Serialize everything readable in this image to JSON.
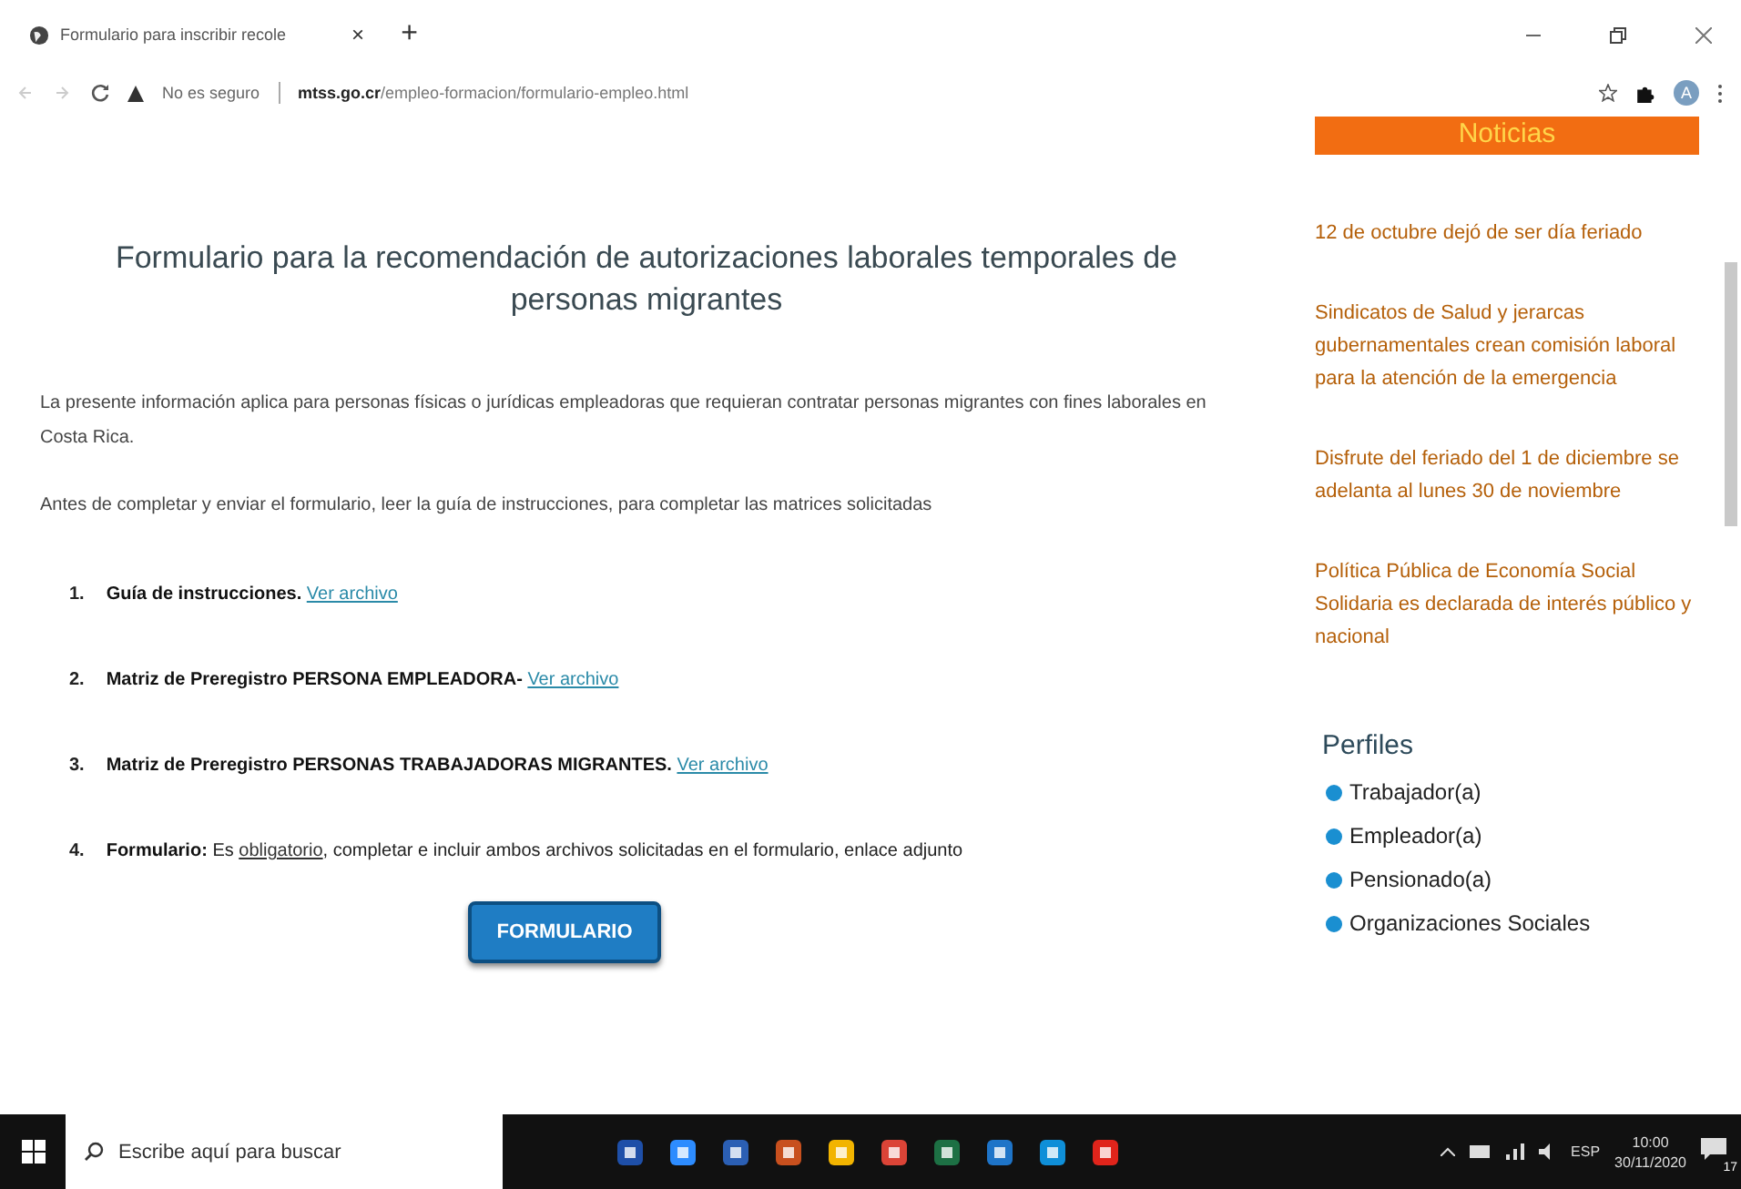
{
  "browser": {
    "tab_title": "Formulario para inscribir recole",
    "close": "×",
    "new_tab": "+",
    "security": "No es seguro",
    "url_host": "mtss.go.cr",
    "url_path": "/empleo-formacion/formulario-empleo.html",
    "profile": "A"
  },
  "main": {
    "title": "Formulario para la recomendación de autorizaciones laborales temporales de personas migrantes",
    "paragraphs": [
      "La presente información aplica para personas físicas o jurídicas empleadoras que requieran contratar personas migrantes con fines laborales en Costa Rica.",
      "Antes de completar y enviar el formulario, leer la guía de instrucciones, para completar las matrices solicitadas"
    ],
    "items": [
      {
        "number": "1.",
        "label": "Guía de instrucciones.",
        "link": "Ver archivo"
      },
      {
        "number": "2.",
        "label": "Matriz de Preregistro PERSONA EMPLEADORA-",
        "link": "Ver archivo"
      },
      {
        "number": "3.",
        "label": "Matriz de Preregistro PERSONAS TRABAJADORAS MIGRANTES.",
        "link": "Ver archivo"
      },
      {
        "number": "4.",
        "label": "Formulario:",
        "prefix": "Es",
        "link": "obligatorio",
        "suffix": ", completar e incluir ambos archivos solicitadas en el formulario, enlace adjunto"
      }
    ],
    "button": "FORMULARIO"
  },
  "sidebar": {
    "news_title": "Noticias",
    "news": [
      "12 de octubre dejó de ser día feriado",
      "Sindicatos de Salud y jerarcas gubernamentales crean comisión laboral para la atención de la emergencia",
      "Disfrute del feriado del 1  de diciembre se adelanta al lunes 30 de noviembre",
      "Política Pública de Economía Social Solidaria es declarada de interés público y nacional"
    ],
    "profiles_title": "Perfiles",
    "profiles": [
      "Trabajador(a)",
      "Empleador(a)",
      "Pensionado(a)",
      "Organizaciones Sociales"
    ]
  },
  "taskbar": {
    "search_placeholder": "Escribe aquí para buscar",
    "language": "ESP",
    "time": "10:00",
    "date": "30/11/2020",
    "notifications": "17"
  }
}
